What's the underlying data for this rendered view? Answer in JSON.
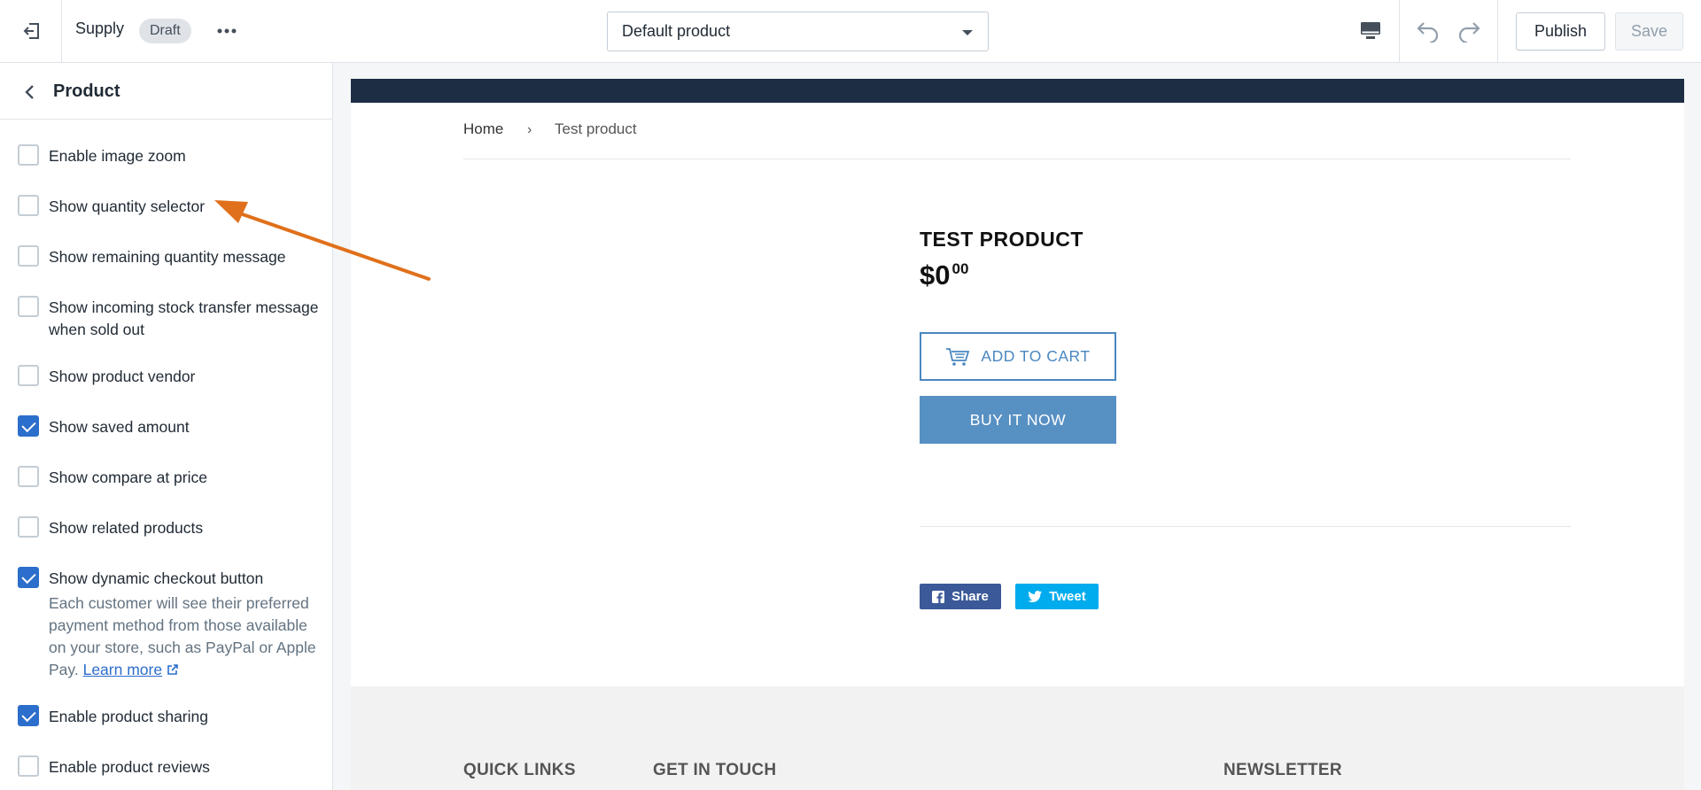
{
  "topbar": {
    "theme_name": "Supply",
    "status_badge": "Draft",
    "template_selected": "Default product",
    "publish_label": "Publish",
    "save_label": "Save",
    "icons": {
      "exit": "exit-icon",
      "more": "more-horizontal-icon",
      "device": "desktop-icon",
      "undo": "undo-icon",
      "redo": "redo-icon"
    }
  },
  "sidebar": {
    "title": "Product",
    "options": [
      {
        "label": "Enable image zoom",
        "checked": false
      },
      {
        "label": "Show quantity selector",
        "checked": false
      },
      {
        "label": "Show remaining quantity message",
        "checked": false
      },
      {
        "label": "Show incoming stock transfer message when sold out",
        "checked": false
      },
      {
        "label": "Show product vendor",
        "checked": false
      },
      {
        "label": "Show saved amount",
        "checked": true
      },
      {
        "label": "Show compare at price",
        "checked": false
      },
      {
        "label": "Show related products",
        "checked": false
      },
      {
        "label": "Show dynamic checkout button",
        "checked": true
      },
      {
        "label": "Enable product sharing",
        "checked": true
      },
      {
        "label": "Enable product reviews",
        "checked": false
      }
    ],
    "dynamic_checkout_help": "Each customer will see their preferred payment method from those available on your store, such as PayPal or Apple Pay.",
    "learn_more_label": "Learn more"
  },
  "preview": {
    "breadcrumb": {
      "home": "Home",
      "separator": "›",
      "current": "Test product"
    },
    "product_title": "TEST PRODUCT",
    "price_main": "$0",
    "price_cents": "00",
    "add_to_cart_label": "ADD TO CART",
    "buy_now_label": "BUY IT NOW",
    "share_label": "Share",
    "tweet_label": "Tweet",
    "footer_headings": [
      "QUICK LINKS",
      "GET IN TOUCH",
      "NEWSLETTER"
    ]
  },
  "colors": {
    "accent": "#2c6ecb",
    "announcement_bar": "#1c2d44",
    "button_blue": "#5790c3",
    "facebook": "#3b5998",
    "twitter": "#00aced",
    "annotation_arrow": "#e0701b"
  }
}
